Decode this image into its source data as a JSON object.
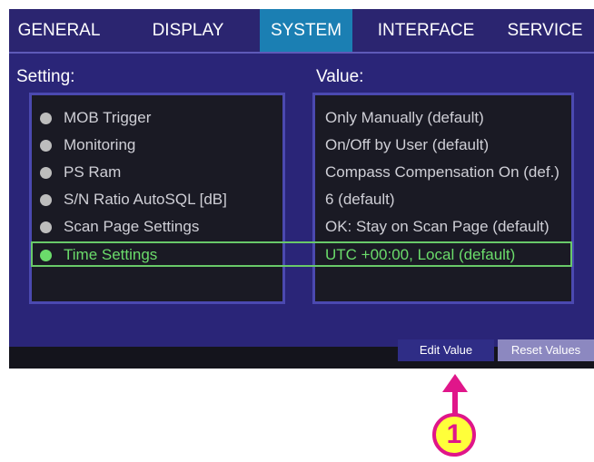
{
  "tabs": [
    {
      "label": "GENERAL"
    },
    {
      "label": "DISPLAY"
    },
    {
      "label": "SYSTEM",
      "active": true
    },
    {
      "label": "INTERFACE"
    },
    {
      "label": "SERVICE"
    }
  ],
  "headers": {
    "setting": "Setting:",
    "value": "Value:"
  },
  "rows": [
    {
      "setting": "MOB Trigger",
      "value": "Only Manually (default)"
    },
    {
      "setting": "Monitoring",
      "value": "On/Off by User (default)"
    },
    {
      "setting": "PS Ram",
      "value": "Compass Compensation On (def.)"
    },
    {
      "setting": "S/N Ratio AutoSQL [dB]",
      "value": "6 (default)"
    },
    {
      "setting": "Scan Page Settings",
      "value": "OK: Stay on Scan Page (default)"
    },
    {
      "setting": "Time Settings",
      "value": "UTC +00:00, Local (default)",
      "selected": true
    }
  ],
  "buttons": {
    "edit": "Edit Value",
    "reset": "Reset Values"
  },
  "callout": {
    "number": "1"
  },
  "colors": {
    "accent_tab": "#1b7fb3",
    "selected": "#6bdc6b",
    "callout_fill": "#ffff3a",
    "callout_border": "#e0168a"
  }
}
